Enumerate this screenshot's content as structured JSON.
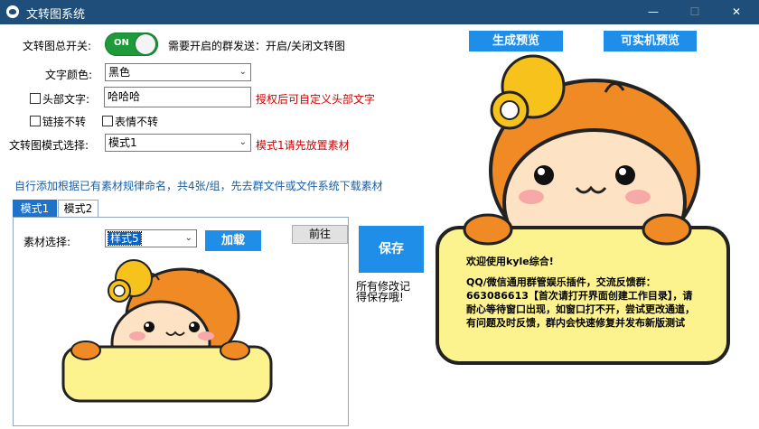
{
  "window": {
    "title": "文转图系统",
    "minimize_glyph": "—",
    "maximize_glyph": "☐",
    "close_glyph": "✕"
  },
  "settings": {
    "master_switch_label": "文转图总开关:",
    "master_switch_state": "ON",
    "master_switch_on": true,
    "switch_hint": "需要开启的群发送：开启/关闭文转图",
    "text_color_label": "文字颜色:",
    "text_color_value": "黑色",
    "header_text_label": "头部文字:",
    "header_text_checked": false,
    "header_text_value": "哈哈哈",
    "header_text_hint": "授权后可自定义头部文字",
    "no_link_label": "链接不转",
    "no_link_checked": false,
    "no_emoji_label": "表情不转",
    "no_emoji_checked": false,
    "mode_label": "文转图模式选择:",
    "mode_value": "模式1",
    "mode_hint": "模式1请先放置素材",
    "material_info": "自行添加根据已有素材规律命名，共4张/组，先去群文件或文件系统下载素材"
  },
  "buttons": {
    "generate_preview": "生成预览",
    "device_preview": "可实机预览",
    "save": "保存",
    "go": "前往",
    "load": "加载"
  },
  "tabs": [
    {
      "label": "模式1",
      "active": true
    },
    {
      "label": "模式2",
      "active": false
    }
  ],
  "mode1_panel": {
    "material_label": "素材选择:",
    "material_value": "样式5"
  },
  "save_note": "所有修改记得保存哦!",
  "preview": {
    "line1": "欢迎使用kyle综合!",
    "line2": "QQ/微信通用群管娱乐插件，交流反馈群：663086613【首次请打开界面创建工作目录】，请耐心等待窗口出现，如窗口打不开，尝试更改通道，有问题及时反馈，群内会快速修复并发布新版测试"
  },
  "colors": {
    "titlebar": "#1e4e79",
    "accent_blue": "#1e8ee8",
    "switch_green": "#1e9a3b",
    "hint_red": "#d00000",
    "info_blue": "#1a5fa8",
    "mascot_orange": "#f08a24",
    "board_yellow": "#fdf38e"
  }
}
